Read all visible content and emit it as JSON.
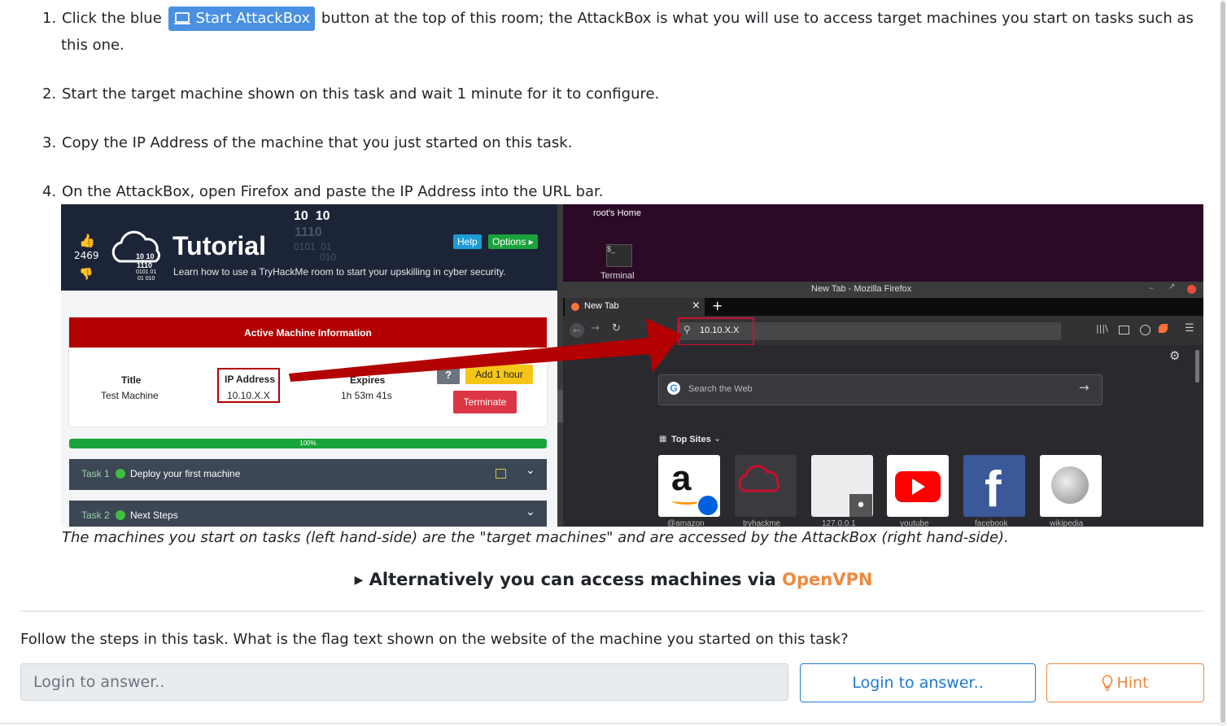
{
  "steps": [
    {
      "num": "1.",
      "pre": "Click the blue",
      "button": "Start AttackBox",
      "post": "button at the top of this room; the AttackBox is what you will use to access target machines you start on tasks such as",
      "post2": "this one."
    },
    {
      "num": "2.",
      "text": "Start the target machine shown on this task and wait 1 minute for it to configure."
    },
    {
      "num": "3.",
      "text": "Copy the IP Address of the machine that you just started on this task."
    },
    {
      "num": "4.",
      "text": "On the AttackBox, open Firefox and paste the IP Address into the URL bar."
    }
  ],
  "screenshot": {
    "left": {
      "votes": "2469",
      "logo_digits": [
        "10 10",
        "1110",
        "0101 01",
        "01 010"
      ],
      "top_digits": "10  10",
      "top_digits2": "1110",
      "top_digits3": "0101  01",
      "top_digits4": "010",
      "title": "Tutorial",
      "subtitle": "Learn how to use a TryHackMe room to start your upskilling in cyber security.",
      "help": "Help",
      "options": "Options ▸",
      "ami_header": "Active Machine Information",
      "title_label": "Title",
      "title_value": "Test Machine",
      "ip_label": "IP Address",
      "ip_value": "10.10.X.X",
      "expires_label": "Expires",
      "expires_value": "1h 53m 41s",
      "qmark": "?",
      "add_hour": "Add 1 hour",
      "terminate": "Terminate",
      "progress": "100%",
      "progress_value": 1.0,
      "task1_label": "Task 1",
      "task1_title": "Deploy your first machine",
      "task2_label": "Task 2",
      "task2_title": "Next Steps"
    },
    "right": {
      "home": "root's Home",
      "terminal": "Terminal",
      "terminal_icon": "$_",
      "window_title": "New Tab - Mozilla Firefox",
      "tab": "New Tab",
      "url": "10.10.X.X",
      "search_placeholder": "Search the Web",
      "top_sites": "Top Sites",
      "sites": [
        "@amazon",
        "tryhackme",
        "127.0.0.1",
        "youtube",
        "facebook",
        "wikipedia"
      ]
    }
  },
  "caption": "The machines you start on tasks (left hand-side) are the \"target machines\" and are accessed by the AttackBox (right hand-side).",
  "alt": {
    "text": "Alternatively you can access machines via ",
    "link": "OpenVPN"
  },
  "question": "Follow the steps in this task. What is the flag text shown on the website of the machine you started on this task?",
  "answer_placeholder": "Login to answer..",
  "login_button": "Login to answer..",
  "hint_button": "Hint",
  "colors": {
    "accent_blue": "#1f78d1",
    "attackbox_blue": "#4a90e2",
    "orange": "#f0883e",
    "red": "#b30000",
    "green": "#19a33b"
  }
}
